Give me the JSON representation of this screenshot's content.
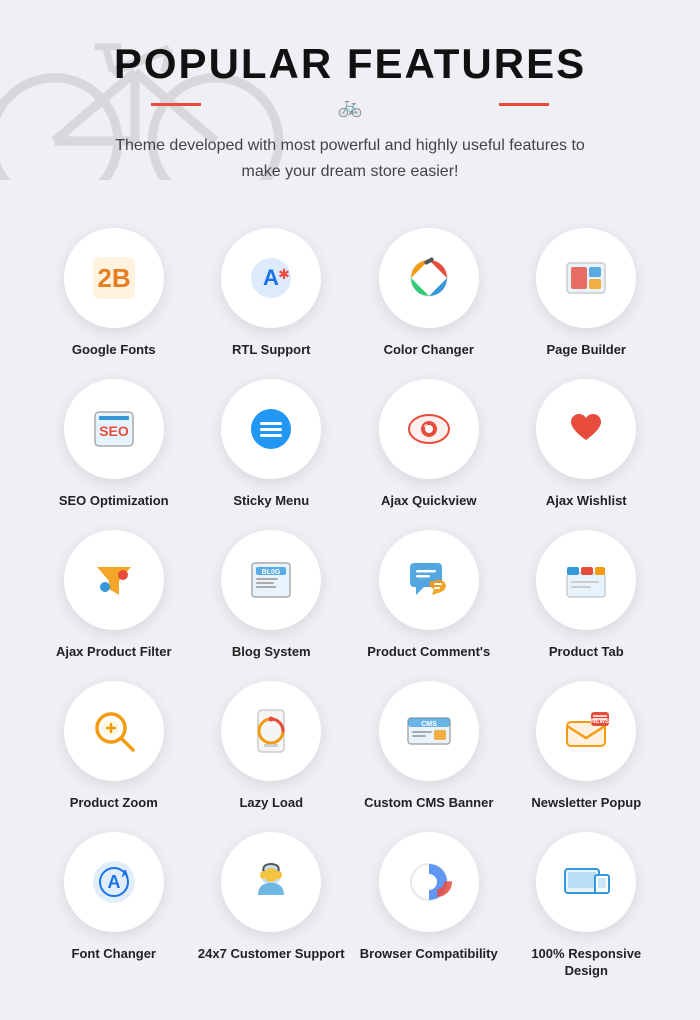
{
  "header": {
    "title": "POPULAR FEATURES",
    "subtitle": "Theme developed with most powerful and highly useful features to make your dream store easier!"
  },
  "features": [
    {
      "id": "google-fonts",
      "label": "Google Fonts",
      "icon": "google-fonts"
    },
    {
      "id": "rtl-support",
      "label": "RTL Support",
      "icon": "rtl-support"
    },
    {
      "id": "color-changer",
      "label": "Color Changer",
      "icon": "color-changer"
    },
    {
      "id": "page-builder",
      "label": "Page Builder",
      "icon": "page-builder"
    },
    {
      "id": "seo-optimization",
      "label": "SEO Optimization",
      "icon": "seo-optimization"
    },
    {
      "id": "sticky-menu",
      "label": "Sticky Menu",
      "icon": "sticky-menu"
    },
    {
      "id": "ajax-quickview",
      "label": "Ajax Quickview",
      "icon": "ajax-quickview"
    },
    {
      "id": "ajax-wishlist",
      "label": "Ajax Wishlist",
      "icon": "ajax-wishlist"
    },
    {
      "id": "ajax-product-filter",
      "label": "Ajax Product Filter",
      "icon": "ajax-product-filter"
    },
    {
      "id": "blog-system",
      "label": "Blog System",
      "icon": "blog-system"
    },
    {
      "id": "product-comments",
      "label": "Product Comment's",
      "icon": "product-comments"
    },
    {
      "id": "product-tab",
      "label": "Product Tab",
      "icon": "product-tab"
    },
    {
      "id": "product-zoom",
      "label": "Product Zoom",
      "icon": "product-zoom"
    },
    {
      "id": "lazy-load",
      "label": "Lazy Load",
      "icon": "lazy-load"
    },
    {
      "id": "custom-cms-banner",
      "label": "Custom CMS Banner",
      "icon": "custom-cms-banner"
    },
    {
      "id": "newsletter-popup",
      "label": "Newsletter Popup",
      "icon": "newsletter-popup"
    },
    {
      "id": "font-changer",
      "label": "Font Changer",
      "icon": "font-changer"
    },
    {
      "id": "customer-support",
      "label": "24x7 Customer Support",
      "icon": "customer-support"
    },
    {
      "id": "browser-compatibility",
      "label": "Browser Compatibility",
      "icon": "browser-compatibility"
    },
    {
      "id": "responsive-design",
      "label": "100% Responsive Design",
      "icon": "responsive-design"
    }
  ]
}
